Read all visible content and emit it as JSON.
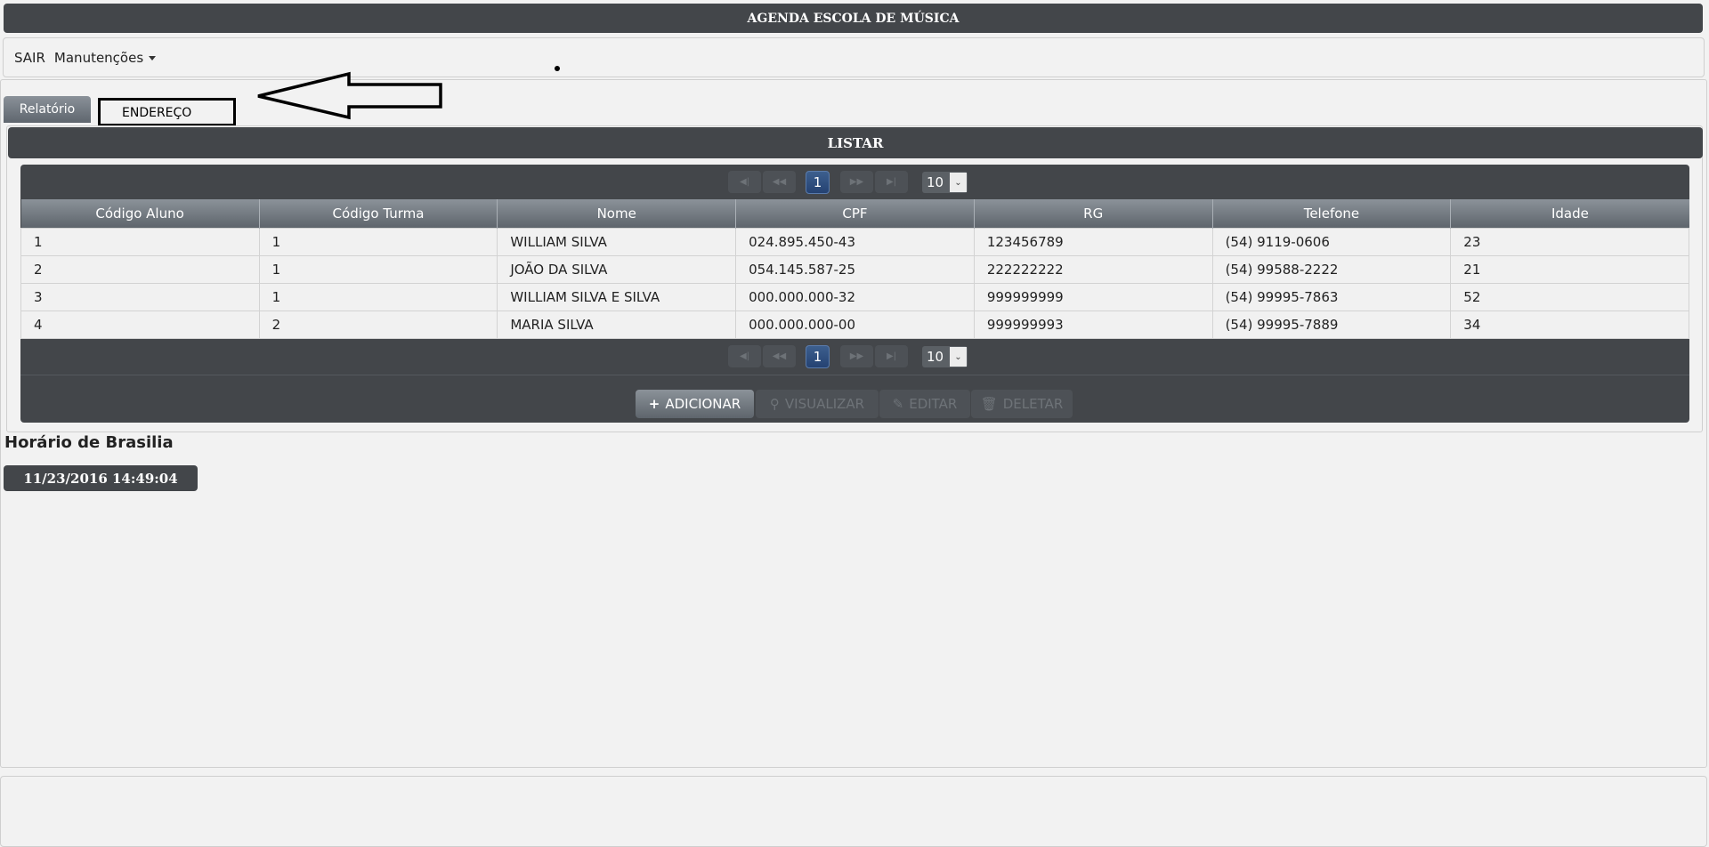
{
  "header": {
    "title": "AGENDA ESCOLA DE MÚSICA"
  },
  "menu": {
    "sair": "SAIR",
    "manutencoes": "Manutenções"
  },
  "tabs": {
    "relatorio": "Relatório",
    "annotation_box": "ENDEREÇO"
  },
  "panel": {
    "title": "LISTAR"
  },
  "paginator": {
    "current_page": "1",
    "rows_per_page": "10",
    "first": "◀|",
    "prev": "◀◀",
    "next": "▶▶",
    "last": "▶|"
  },
  "table": {
    "columns": [
      "Código Aluno",
      "Código Turma",
      "Nome",
      "CPF",
      "RG",
      "Telefone",
      "Idade"
    ],
    "rows": [
      [
        "1",
        "1",
        "WILLIAM SILVA",
        "024.895.450-43",
        "123456789",
        "(54) 9119-0606",
        "23"
      ],
      [
        "2",
        "1",
        "JOÃO DA SILVA",
        "054.145.587-25",
        "222222222",
        "(54) 99588-2222",
        "21"
      ],
      [
        "3",
        "1",
        "WILLIAM SILVA E SILVA",
        "000.000.000-32",
        "999999999",
        "(54) 99995-7863",
        "52"
      ],
      [
        "4",
        "2",
        "MARIA SILVA",
        "000.000.000-00",
        "999999993",
        "(54) 99995-7889",
        "34"
      ]
    ]
  },
  "actions": {
    "add": "ADICIONAR",
    "view": "VISUALIZAR",
    "edit": "EDITAR",
    "delete": "DELETAR"
  },
  "clock": {
    "label": "Horário de Brasilia",
    "value": "11/23/2016 14:49:04"
  }
}
